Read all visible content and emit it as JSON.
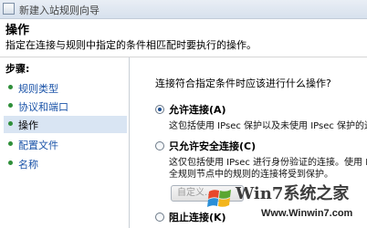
{
  "window": {
    "title": "新建入站规则向导"
  },
  "header": {
    "title": "操作",
    "description": "指定在连接与规则中指定的条件相匹配时要执行的操作。"
  },
  "sidebar": {
    "steps_label": "步骤:",
    "items": [
      {
        "label": "规则类型",
        "active": false
      },
      {
        "label": "协议和端口",
        "active": false
      },
      {
        "label": "操作",
        "active": true
      },
      {
        "label": "配置文件",
        "active": false
      },
      {
        "label": "名称",
        "active": false
      }
    ]
  },
  "main": {
    "question": "连接符合指定条件时应该进行什么操作?",
    "options": [
      {
        "label": "允许连接(A)",
        "checked": true,
        "desc": [
          "这包括使用 IPsec 保护以及未使用 IPsec 保护的连接"
        ]
      },
      {
        "label": "只允许安全连接(C)",
        "checked": false,
        "desc": [
          "这仅包括使用 IPsec 进行身份验证的连接。使用 IPs",
          "全规则节点中的规则的连接将受到保护。"
        ]
      },
      {
        "label": "阻止连接(K)",
        "checked": false,
        "desc": []
      }
    ],
    "customize_button": "自定义..."
  },
  "watermark": {
    "text": "Win7系统之家",
    "url": "Www.Winwin7.com"
  }
}
